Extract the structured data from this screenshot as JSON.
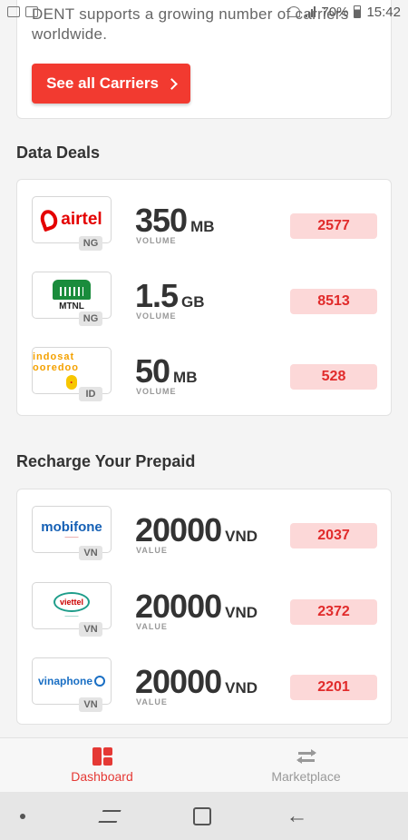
{
  "status_bar": {
    "battery": "70%",
    "time": "15:42"
  },
  "carriers": {
    "text": "DENT supports a growing number of carriers worldwide.",
    "button_label": "See all Carriers"
  },
  "data_deals": {
    "title": "Data Deals",
    "items": [
      {
        "logo": "airtel",
        "country": "NG",
        "amount": "350",
        "unit": "MB",
        "sub": "VOLUME",
        "price": "2577"
      },
      {
        "logo": "MTNL",
        "country": "NG",
        "amount": "1.5",
        "unit": "GB",
        "sub": "VOLUME",
        "price": "8513"
      },
      {
        "logo": "indosat ooredoo",
        "country": "ID",
        "amount": "50",
        "unit": "MB",
        "sub": "VOLUME",
        "price": "528"
      }
    ]
  },
  "recharge": {
    "title": "Recharge Your Prepaid",
    "items": [
      {
        "logo": "mobifone",
        "country": "VN",
        "amount": "20000",
        "unit": "VND",
        "sub": "VALUE",
        "price": "2037"
      },
      {
        "logo": "viettel",
        "country": "VN",
        "amount": "20000",
        "unit": "VND",
        "sub": "VALUE",
        "price": "2372"
      },
      {
        "logo": "vinaphone",
        "country": "VN",
        "amount": "20000",
        "unit": "VND",
        "sub": "VALUE",
        "price": "2201"
      }
    ]
  },
  "bottom_nav": {
    "dashboard": "Dashboard",
    "marketplace": "Marketplace",
    "active_color": "#e53935",
    "inactive_color": "#999999"
  },
  "colors": {
    "accent": "#f23a30",
    "price_bg": "#fcd8d8",
    "price_text": "#e12b2b"
  }
}
